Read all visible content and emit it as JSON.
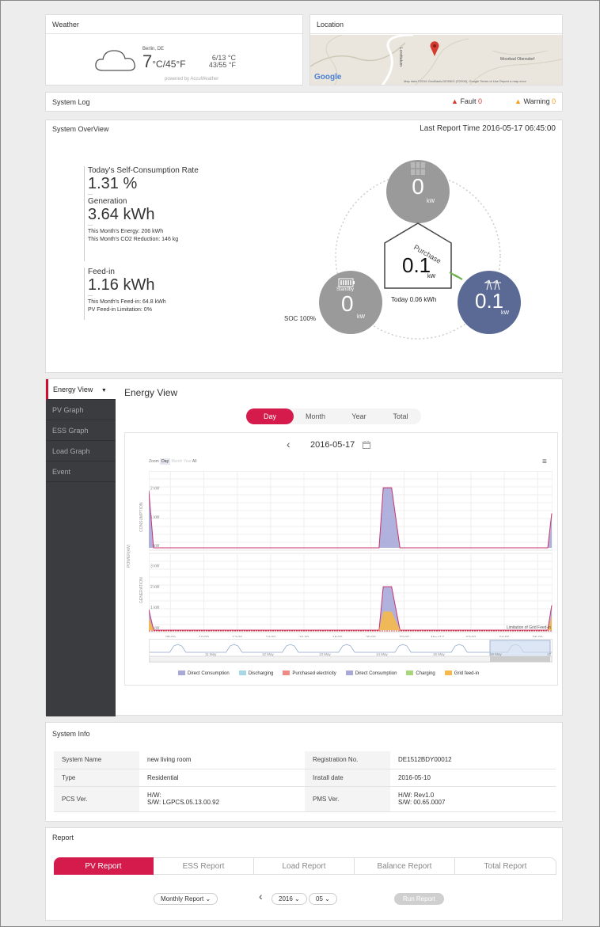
{
  "weather": {
    "title": "Weather",
    "city": "Berlin, DE",
    "temp_main": "7",
    "temp_units": "°C/45°F",
    "range_c": "6/13 °C",
    "range_f": "43/55 °F",
    "powered": "powered by AccuWeather"
  },
  "location": {
    "title": "Location",
    "place_label": "Moorbad Obersdorf",
    "street_label": "Lorettatum",
    "google": "Google",
    "attribution": "Map data ©2016 GeoBasis-DE/BKG (©2009), Google   Terms of Use   Report a map error"
  },
  "system_log": {
    "title": "System Log",
    "fault_label": "Fault",
    "fault_count": "0",
    "warning_label": "Warning",
    "warning_count": "0"
  },
  "overview": {
    "title": "System OverView",
    "last_report": "Last Report Time 2016-05-17 06:45:00",
    "self_consumption_label": "Today's Self-Consumption Rate",
    "self_consumption_value": "1.31 %",
    "generation_label": "Generation",
    "generation_value": "3.64 kWh",
    "month_energy": "This Month's Energy: 206 kWh",
    "month_co2": "This Month's CO2 Reduction: 146 kg",
    "feedin_label": "Feed-in",
    "feedin_value": "1.16 kWh",
    "month_feedin": "This Month's Feed-in: 64.8 kWh",
    "pv_limit": "PV Feed-in Limitation: 0%",
    "dash": "—",
    "pv_value": "0",
    "pv_unit": "kW",
    "home_value": "0.1",
    "home_unit": "kW",
    "home_today": "Today 0.06 kWh",
    "purchase": "Purchase",
    "battery_status": "Standby",
    "battery_value": "0",
    "battery_unit": "kW",
    "soc": "SOC 100%",
    "grid_value": "0.1",
    "grid_unit": "kW"
  },
  "energy": {
    "dropdown_label": "Energy View",
    "side_items": [
      "PV Graph",
      "ESS Graph",
      "Load Graph",
      "Event"
    ],
    "title": "Energy View",
    "periods": [
      "Day",
      "Month",
      "Year",
      "Total"
    ],
    "date": "2016-05-17",
    "zoom_label": "Zoom",
    "zoom_options": [
      "Day",
      "Month",
      "Year",
      "All"
    ],
    "yaxis_power": "POWER(kW)",
    "yaxis_consumption": "CONSUMPTION",
    "yaxis_generation": "GENERATION",
    "limit_label": "Limitation of Grid Feed-in",
    "x_ticks": [
      "08:00",
      "10:00",
      "12:00",
      "14:00",
      "16:00",
      "18:00",
      "20:00",
      "22:00",
      "May/17",
      "02:00",
      "04:00",
      "06:00"
    ],
    "nav_ticks": [
      "11 May",
      "12 May",
      "13 May",
      "14 May",
      "15 May",
      "16 May",
      "17 May"
    ],
    "legend": [
      {
        "name": "Direct Consumption",
        "color": "#a9a9d9"
      },
      {
        "name": "Discharging",
        "color": "#a8d8e6"
      },
      {
        "name": "Purchased electricity",
        "color": "#f08a84"
      },
      {
        "name": "Direct Consumption",
        "color": "#a9a9d9"
      },
      {
        "name": "Charging",
        "color": "#a9d67a"
      },
      {
        "name": "Grid feed-in",
        "color": "#f6b94a"
      }
    ]
  },
  "chart_data": [
    {
      "type": "area",
      "title": "CONSUMPTION",
      "ylabel": "POWER(kW)",
      "y_ticks": [
        "2 kW",
        "1 kW",
        "0 kW"
      ],
      "x": [
        "06:45",
        "20:30",
        "21:00",
        "21:15",
        "06:45"
      ],
      "series": [
        {
          "name": "Direct Consumption",
          "values": [
            2.0,
            0.0,
            2.1,
            2.1,
            0.0
          ]
        }
      ]
    },
    {
      "type": "area",
      "title": "GENERATION",
      "ylabel": "POWER(kW)",
      "y_ticks": [
        "3 kW",
        "2 kW",
        "1 kW",
        "0 kW"
      ],
      "x": [
        "06:45",
        "20:30",
        "21:00",
        "21:15",
        "06:45"
      ],
      "series": [
        {
          "name": "Direct Consumption",
          "values": [
            1.0,
            0.0,
            2.1,
            2.1,
            0.0
          ]
        },
        {
          "name": "Grid feed-in",
          "values": [
            0.6,
            0.0,
            0.9,
            0.9,
            0.0
          ]
        }
      ]
    }
  ],
  "system_info": {
    "title": "System Info",
    "rows": [
      {
        "l1": "System Name",
        "v1": "new living room",
        "l2": "Registration No.",
        "v2": "DE1512BDY00012"
      },
      {
        "l1": "Type",
        "v1": "Residential",
        "l2": "Install date",
        "v2": "2016-05-10"
      },
      {
        "l1": "PCS Ver.",
        "v1": "H/W:\nS/W: LGPCS.05.13.00.92",
        "l2": "PMS Ver.",
        "v2": "H/W: Rev1.0\nS/W: 00.65.0007"
      }
    ]
  },
  "report": {
    "title": "Report",
    "tabs": [
      "PV Report",
      "ESS Report",
      "Load Report",
      "Balance Report",
      "Total Report"
    ],
    "report_type": "Monthly Report",
    "year": "2016",
    "month": "05",
    "run": "Run Report"
  },
  "colors": {
    "accent": "#d41b4b",
    "grid_circle": "#5a6a94",
    "node_gray": "#9a9a9a"
  }
}
